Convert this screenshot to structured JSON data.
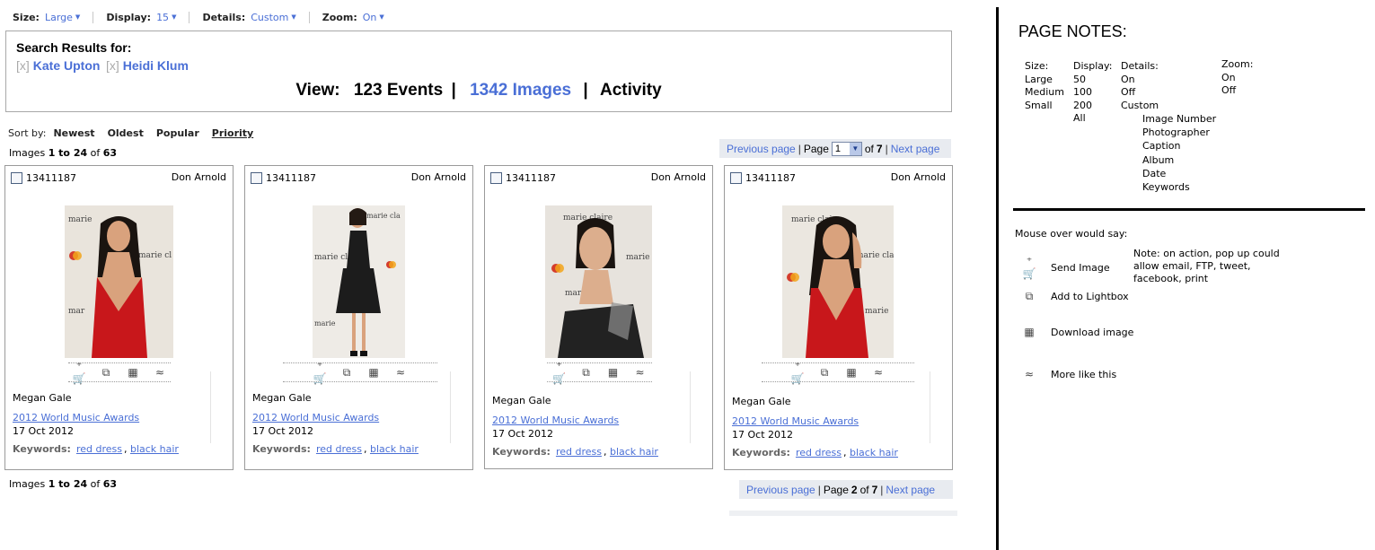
{
  "toolbar": {
    "size": {
      "label": "Size:",
      "value": "Large"
    },
    "display": {
      "label": "Display:",
      "value": "15"
    },
    "details": {
      "label": "Details:",
      "value": "Custom"
    },
    "zoom": {
      "label": "Zoom:",
      "value": "On"
    }
  },
  "search": {
    "title": "Search Results for:",
    "terms": [
      {
        "remove": "[x]",
        "name": "Kate Upton"
      },
      {
        "remove": "[x]",
        "name": "Heidi Klum"
      }
    ],
    "view_label": "View:",
    "events": "123 Events",
    "images": "1342 Images",
    "activity": "Activity",
    "sep": "|"
  },
  "sort": {
    "label": "Sort by:",
    "options": [
      "Newest",
      "Oldest",
      "Popular",
      "Priority"
    ]
  },
  "counts": {
    "prefix": "Images",
    "range": "1 to 24",
    "of": "of",
    "total": "63"
  },
  "pager_top": {
    "prev": "Previous page",
    "page_label": "Page",
    "page_value": "1",
    "of_label": "of",
    "total_pages": "7",
    "next": "Next page"
  },
  "pager_bottom": {
    "prev": "Previous page",
    "page_label": "Page",
    "page_value": "2",
    "of_label": "of",
    "total_pages": "7",
    "next": "Next page"
  },
  "cards": [
    {
      "image_number": "13411187",
      "photographer": "Don Arnold",
      "subject": "Megan Gale",
      "event": "2012 World Music Awards",
      "date": "17 Oct 2012",
      "keywords_label": "Keywords:",
      "keywords": [
        "red dress",
        "black hair"
      ],
      "photo_alt": "Woman in red dress at marie claire event"
    },
    {
      "image_number": "13411187",
      "photographer": "Don Arnold",
      "subject": "Megan Gale",
      "event": "2012 World Music Awards",
      "date": "17 Oct 2012",
      "keywords_label": "Keywords:",
      "keywords": [
        "red dress",
        "black hair"
      ],
      "photo_alt": "Woman in black dress at marie claire event"
    },
    {
      "image_number": "13411187",
      "photographer": "Don Arnold",
      "subject": "Megan Gale",
      "event": "2012 World Music Awards",
      "date": "17 Oct 2012",
      "keywords_label": "Keywords:",
      "keywords": [
        "red dress",
        "black hair"
      ],
      "photo_alt": "Woman portrait at marie claire event"
    },
    {
      "image_number": "13411187",
      "photographer": "Don Arnold",
      "subject": "Megan Gale",
      "event": "2012 World Music Awards",
      "date": "17 Oct 2012",
      "keywords_label": "Keywords:",
      "keywords": [
        "red dress",
        "black hair"
      ],
      "photo_alt": "Woman in red dress touching hair"
    }
  ],
  "action_icons": [
    "send-image-icon",
    "add-to-lightbox-icon",
    "download-image-icon",
    "more-like-this-icon"
  ],
  "notes": {
    "title": "PAGE NOTES:",
    "size": {
      "header": "Size:",
      "items": [
        "Large",
        "Medium",
        "Small"
      ]
    },
    "display": {
      "header": "Display:",
      "items": [
        "50",
        "100",
        "200",
        "All"
      ]
    },
    "details": {
      "header": "Details:",
      "items": [
        "On",
        "Off",
        "Custom"
      ],
      "custom_items": [
        "Image Number",
        "Photographer",
        "Caption",
        "Album",
        "Date",
        "Keywords"
      ]
    },
    "zoom": {
      "header": "Zoom:",
      "items": [
        "On",
        "Off"
      ]
    },
    "mouseover_title": "Mouse over would say:",
    "mouseover": [
      "Send Image",
      "Add to Lightbox",
      "Download image",
      "More like this"
    ],
    "note": "Note: on action, pop up could allow email, FTP, tweet, facebook, print"
  },
  "colors": {
    "link": "#4a6fd6",
    "pager_bg": "#e8ebf0",
    "red_dress": "#c8171b",
    "black_dress": "#1c1c1c"
  }
}
